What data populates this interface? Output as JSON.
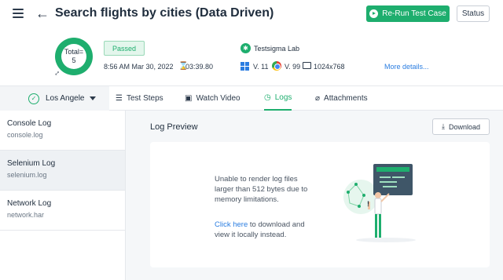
{
  "header": {
    "title": "Search flights by cities (Data Driven)",
    "rerun_label": "Re-Run Test Case",
    "status_label": "Status"
  },
  "summary": {
    "total_label": "Total=",
    "total_value": "5",
    "result": "Passed",
    "run_time": "8:56 AM Mar 30, 2022",
    "duration": "03:39.80",
    "lab": "Testsigma Lab",
    "os_version": "V. 11",
    "browser_version": "V. 99",
    "resolution": "1024x768",
    "more_details": "More details..."
  },
  "tabs": {
    "device": "Los Angele",
    "items": [
      {
        "label": "Test Steps",
        "icon": "list-icon"
      },
      {
        "label": "Watch Video",
        "icon": "video-icon"
      },
      {
        "label": "Logs",
        "icon": "clock-icon"
      },
      {
        "label": "Attachments",
        "icon": "paperclip-icon"
      }
    ]
  },
  "sidebar": {
    "items": [
      {
        "title": "Console Log",
        "file": "console.log"
      },
      {
        "title": "Selenium Log",
        "file": "selenium.log"
      },
      {
        "title": "Network Log",
        "file": "network.har"
      }
    ]
  },
  "preview": {
    "title": "Log Preview",
    "download_label": "Download",
    "message": "Unable to render log files larger than 512 bytes due to memory limitations.",
    "link_text": "Click here",
    "link_suffix": " to download and view it locally instead."
  },
  "colors": {
    "accent": "#1eae6e",
    "link": "#2a7de1"
  }
}
